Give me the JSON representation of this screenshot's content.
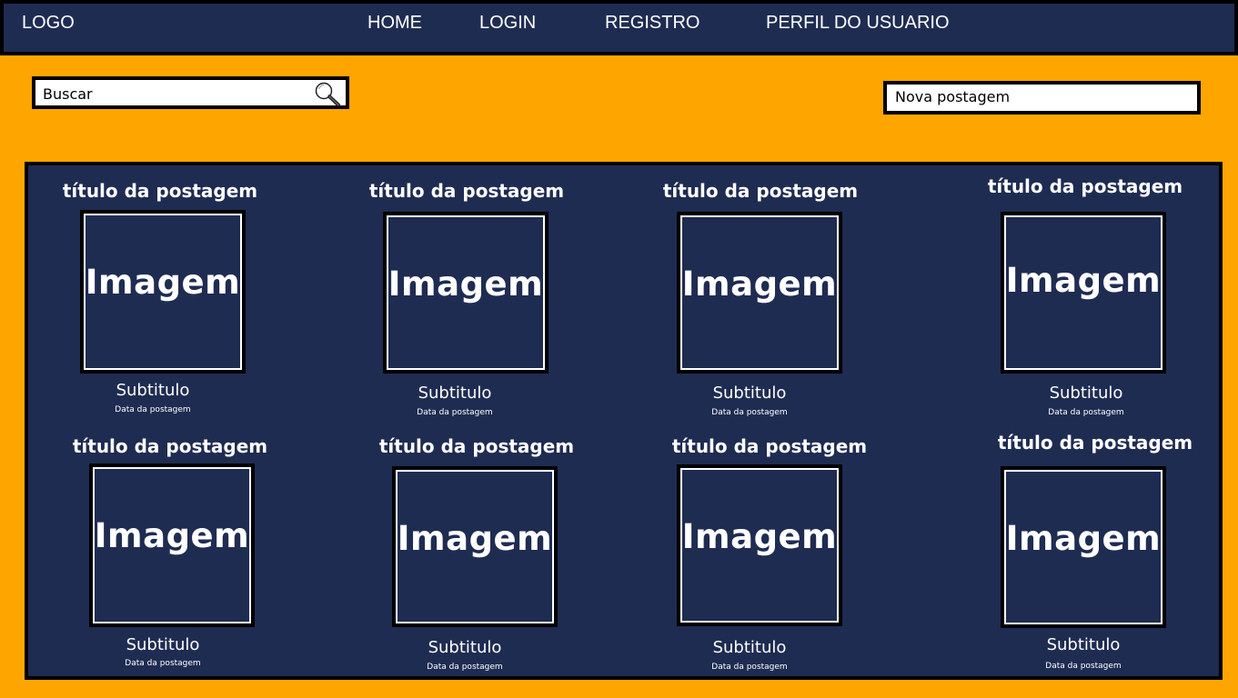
{
  "header": {
    "logo": "LOGO",
    "nav": [
      "HOME",
      "LOGIN",
      "REGISTRO",
      "PERFIL DO USUARIO"
    ]
  },
  "search": {
    "placeholder": "Buscar",
    "icon": "search-icon"
  },
  "new_post": {
    "label": "Nova postagem"
  },
  "colors": {
    "page_background": "#FFA500",
    "panel_background": "#1F2C52",
    "border": "#000000",
    "text_light": "#FFFFFF"
  },
  "posts": [
    {
      "title": "título da postagem",
      "image": "Imagem",
      "subtitle": "Subtitulo",
      "date": "Data da postagem"
    },
    {
      "title": "título da postagem",
      "image": "Imagem",
      "subtitle": "Subtitulo",
      "date": "Data da postagem"
    },
    {
      "title": "título da postagem",
      "image": "Imagem",
      "subtitle": "Subtitulo",
      "date": "Data da postagem"
    },
    {
      "title": "título da postagem",
      "image": "Imagem",
      "subtitle": "Subtitulo",
      "date": "Data da postagem"
    },
    {
      "title": "título da postagem",
      "image": "Imagem",
      "subtitle": "Subtitulo",
      "date": "Data da postagem"
    },
    {
      "title": "título da postagem",
      "image": "Imagem",
      "subtitle": "Subtitulo",
      "date": "Data da postagem"
    },
    {
      "title": "título da postagem",
      "image": "Imagem",
      "subtitle": "Subtitulo",
      "date": "Data da postagem"
    },
    {
      "title": "título da postagem",
      "image": "Imagem",
      "subtitle": "Subtitulo",
      "date": "Data da postagem"
    }
  ]
}
